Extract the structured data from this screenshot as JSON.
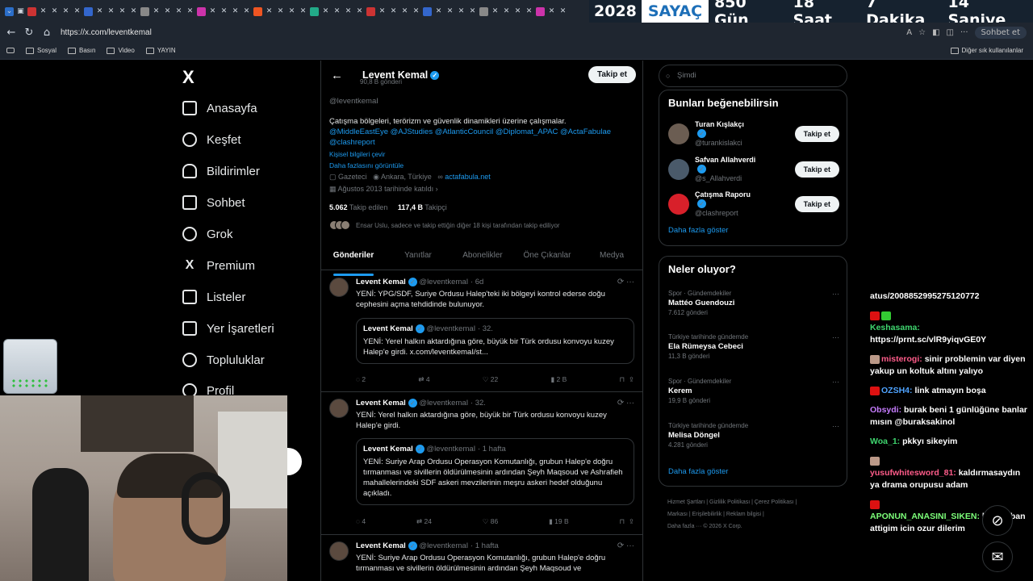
{
  "browser": {
    "counter": {
      "year": "2028",
      "label": "SAYAÇ",
      "units": [
        "850 Gün",
        "18 Saat",
        "7 Dakika",
        "14 Saniye"
      ]
    },
    "url": "https://x.com/leventkemal",
    "bookmarks": [
      "Sosyal",
      "Basın",
      "Video",
      "YAYIN"
    ],
    "other_bookmarks": "Diğer sık kullanılanlar",
    "copilot": "Sohbet et"
  },
  "leftnav": {
    "logo": "X",
    "items": [
      "Anasayfa",
      "Keşfet",
      "Bildirimler",
      "Sohbet",
      "Grok",
      "Premium",
      "Listeler",
      "Yer İşaretleri",
      "Topluluklar",
      "Profil"
    ]
  },
  "profile": {
    "name": "Levent Kemal",
    "post_count": "90,8 B gönderi",
    "follow_label": "Takip et",
    "handle": "@leventkemaI",
    "bio": "Çatışma bölgeleri, terörizm ve güvenlik dinamikleri üzerine çalışmalar.",
    "bio_links": "@MiddleEastEye @AJStudies @AtlanticCouncil @Diplomat_APAC @ActaFabulae @clashreport",
    "translate": "Kişisel bilgileri çevir",
    "show_more": "Daha fazlasını görüntüle",
    "category": "Gazeteci",
    "location": "Ankara, Türkiye",
    "website": "actafabula.net",
    "joined": "Ağustos 2013 tarihinde katıldı",
    "following_num": "5.062",
    "following_lbl": "Takip edilen",
    "followers_num": "117,4 B",
    "followers_lbl": "Takipçi",
    "followed_by": "Ensar Uslu, sadece ve takip ettiğin diğer 18 kişi tarafından takip ediliyor"
  },
  "tabs": [
    "Gönderiler",
    "Yanıtlar",
    "Abonelikler",
    "Öne Çıkanlar",
    "Medya"
  ],
  "tweets": [
    {
      "name": "Levent Kemal",
      "handle": "@leventkemaI",
      "time": "· 6d",
      "text": "YENİ: YPG/SDF, Suriye Ordusu Halep'teki iki bölgeyi kontrol ederse doğu cephesini açma tehdidinde bulunuyor.",
      "quote": {
        "name": "Levent Kemal",
        "handle": "@leventkemaI",
        "time": "· 32.",
        "text": "YENİ: Yerel halkın aktardığına göre, büyük bir Türk ordusu konvoyu kuzey Halep'e girdi. x.com/leventkemaI/st..."
      },
      "replies": "2",
      "reposts": "4",
      "likes": "22",
      "views": "2 B"
    },
    {
      "name": "Levent Kemal",
      "handle": "@leventkemaI",
      "time": "· 32.",
      "text": "YENİ: Yerel halkın aktardığına göre, büyük bir Türk ordusu konvoyu kuzey Halep'e girdi.",
      "quote": {
        "name": "Levent Kemal",
        "handle": "@leventkemaI",
        "time": "· 1 hafta",
        "text": "YENİ: Suriye Arap Ordusu Operasyon Komutanlığı, grubun Halep'e doğru tırmanması ve sivillerin öldürülmesinin ardından Şeyh Maqsoud ve Ashrafieh mahallelerindeki SDF askeri mevzilerinin meşru askeri hedef olduğunu açıkladı."
      },
      "replies": "4",
      "reposts": "24",
      "likes": "86",
      "views": "19 B"
    },
    {
      "name": "Levent Kemal",
      "handle": "@leventkemaI",
      "time": "· 1 hafta",
      "text": "YENİ: Suriye Arap Ordusu Operasyon Komutanlığı, grubun Halep'e doğru tırmanması ve sivillerin öldürülmesinin ardından Şeyh Maqsoud ve"
    }
  ],
  "right": {
    "search_placeholder": "Şimdi",
    "wtf_title": "Bunları beğenebilirsin",
    "wtf": [
      {
        "name": "Turan Kışlakçı",
        "handle": "@turankislakci",
        "btn": "Takip et"
      },
      {
        "name": "Safvan Allahverdi",
        "handle": "@s_Allahverdi",
        "btn": "Takip et"
      },
      {
        "name": "Çatışma Raporu",
        "handle": "@clashreport",
        "btn": "Takip et"
      }
    ],
    "show_more": "Daha fazla göster",
    "trends_title": "Neler oluyor?",
    "trends": [
      {
        "ctx": "Spor · Gündemdekiler",
        "name": "Mattéo Guendouzi",
        "count": "7.612 gönderi"
      },
      {
        "ctx": "Türkiye tarihinde gündemde",
        "name": "Ela Rümeysa Cebeci",
        "count": "11,3 B gönderi"
      },
      {
        "ctx": "Spor · Gündemdekiler",
        "name": "Kerem",
        "count": "19,9 B gönderi"
      },
      {
        "ctx": "Türkiye tarihinde gündemde",
        "name": "Melisa Döngel",
        "count": "4.281 gönderi"
      }
    ],
    "show_more2": "Daha fazla göster",
    "footer": [
      "Hizmet Şartları",
      "Gizlilik Politikası",
      "Çerez Politikası",
      "Markası",
      "Erişilebilirlik",
      "Reklam bilgisi",
      "Daha fazla ···",
      "© 2026 X Corp."
    ]
  },
  "chat": [
    {
      "user": "",
      "msg": "atus/2008852995275120772",
      "color": "#ffffff"
    },
    {
      "user": "Keshasama:",
      "msg": "https://prnt.sc/vlR9yiqvGE0Y",
      "color": "#3fd66f"
    },
    {
      "user": "misterogi:",
      "msg": "sinir problemin var diyen yakup un koltuk altını yalıyo",
      "color": "#ff5c8a"
    },
    {
      "user": "OZSH4:",
      "msg": "link atmayın boşa",
      "color": "#4fa3ff"
    },
    {
      "user": "Obsydi:",
      "msg": "burak beni 1 günlüğüne banlar mısın @buraksakinol",
      "color": "#c77dff"
    },
    {
      "user": "Woa_1:",
      "msg": "pkkyı sikeyim",
      "color": "#3fd66f"
    },
    {
      "user": "yusufwhitesword_81:",
      "msg": "kaldırmasaydın ya drama orupusu adam",
      "color": "#ff5c8a"
    },
    {
      "user": "APONUN_ANASINI_SIKEN:",
      "msg": "haksiz ban attigim icin ozur dilerim",
      "color": "#7dff7a"
    }
  ]
}
